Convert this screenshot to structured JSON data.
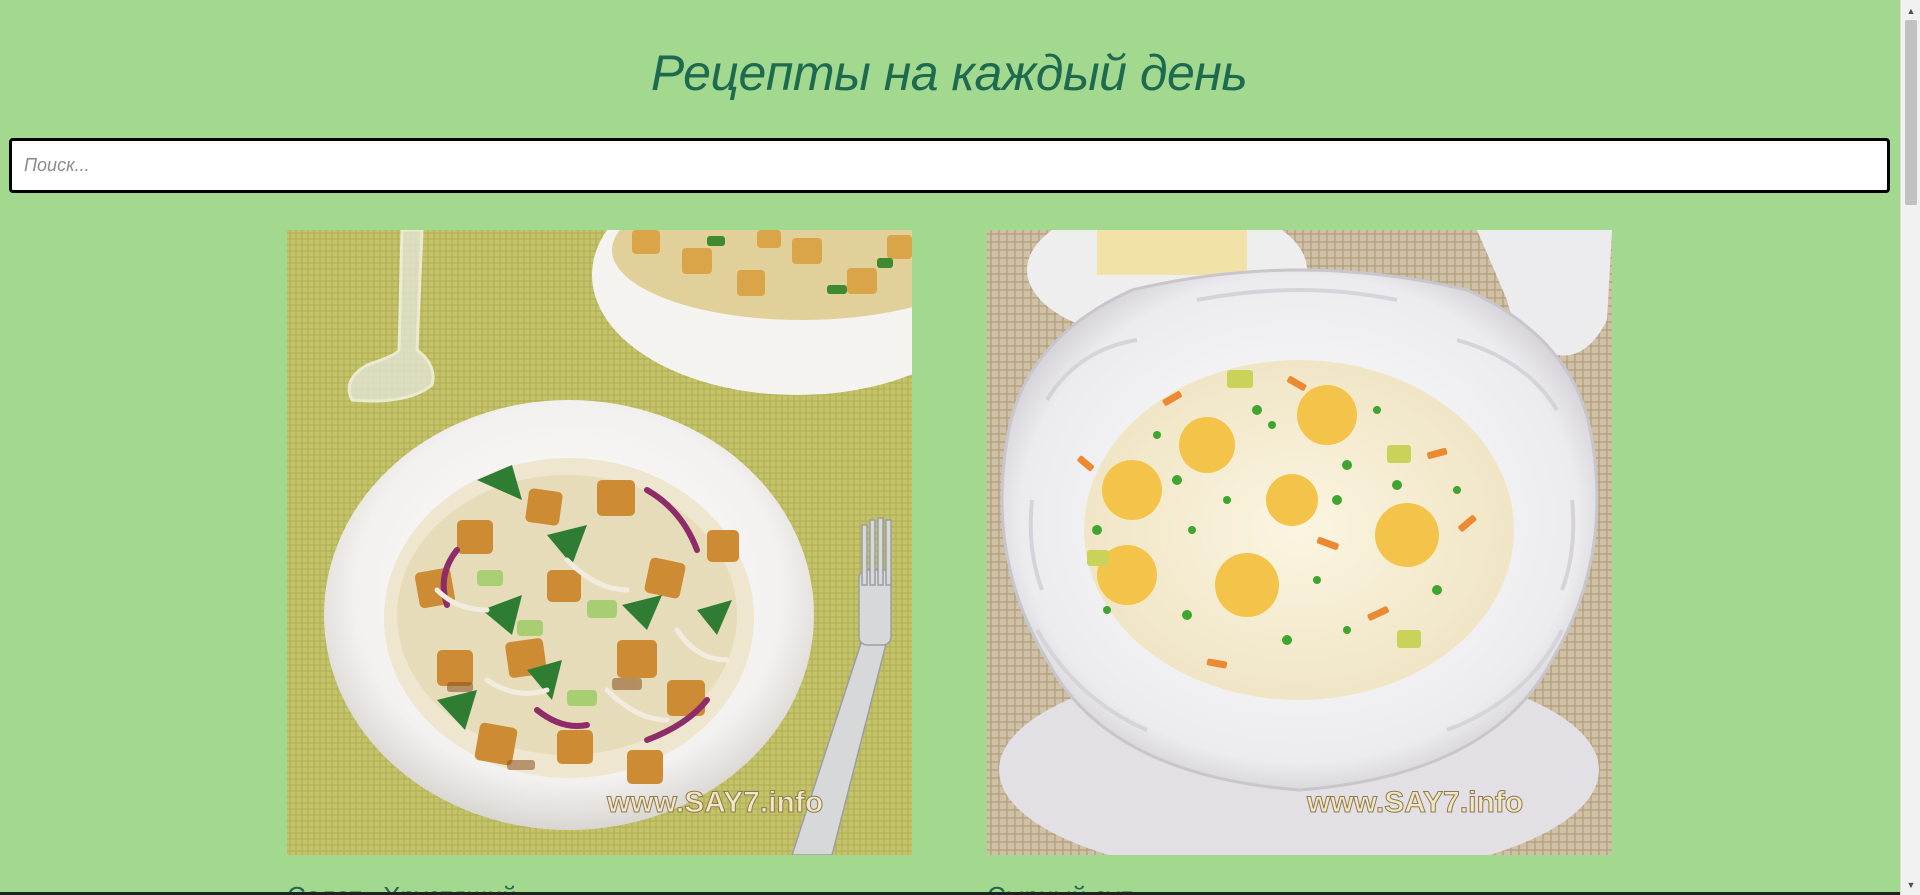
{
  "header": {
    "title": "Рецепты на каждый день"
  },
  "search": {
    "placeholder": "Поиск...",
    "value": ""
  },
  "recipes": [
    {
      "title": "Салат «Хрустящий»",
      "watermark": "www.SAY7.info",
      "image": "salad-with-croutons-chicken-cucumber"
    },
    {
      "title": "Сырный суп",
      "watermark": "www.SAY7.info",
      "image": "cheese-soup-in-white-bowl"
    }
  ],
  "colors": {
    "background": "#a2d98e",
    "title": "#1e6a50"
  },
  "icons": {
    "scroll_up": "scroll-up-arrow-icon",
    "scroll_down": "scroll-down-arrow-icon"
  }
}
